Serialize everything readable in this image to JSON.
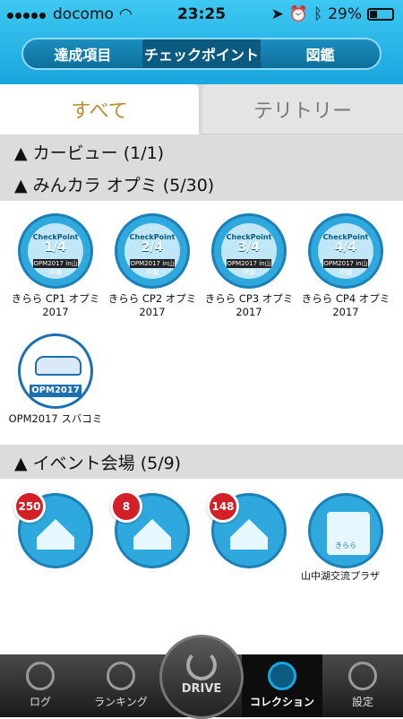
{
  "status": {
    "carrier": "docomo",
    "time": "23:25",
    "battery": "29%"
  },
  "segments": [
    "達成項目",
    "チェックポイント",
    "図鑑"
  ],
  "segment_active": 1,
  "tabs": [
    "すべて",
    "テリトリー"
  ],
  "sections": {
    "carview": "▲ カービュー (1/1)",
    "minkara": "▲ みんカラ オプミ (5/30)",
    "event": "▲ イベント会場 (5/9)"
  },
  "checkpoints": [
    {
      "name": "きらら CP1 オプミ\n2017",
      "cp": "CheckPoint",
      "num": "1/4",
      "opm": "OPM2017 in山中湖"
    },
    {
      "name": "きらら CP2 オプミ\n2017",
      "cp": "CheckPoint",
      "num": "2/4",
      "opm": "OPM2017 in山中湖"
    },
    {
      "name": "きらら CP3 オプミ\n2017",
      "cp": "CheckPoint",
      "num": "3/4",
      "opm": "OPM2017 in山中湖"
    },
    {
      "name": "きらら CP4 オプミ\n2017",
      "cp": "CheckPoint",
      "num": "4/4",
      "opm": "OPM2017 in山中湖"
    }
  ],
  "subaru": {
    "name": "OPM2017 スバコミ",
    "badge_text": "OPM2017"
  },
  "events": [
    {
      "count": "250"
    },
    {
      "count": "8"
    },
    {
      "count": "148"
    }
  ],
  "event4_label": "きらら",
  "cutoff_text": "山中湖交流プラザ",
  "bottom": {
    "log": "ログ",
    "ranking": "ランキング",
    "drive": "DRIVE",
    "collection": "コレクション",
    "settings": "設定"
  }
}
